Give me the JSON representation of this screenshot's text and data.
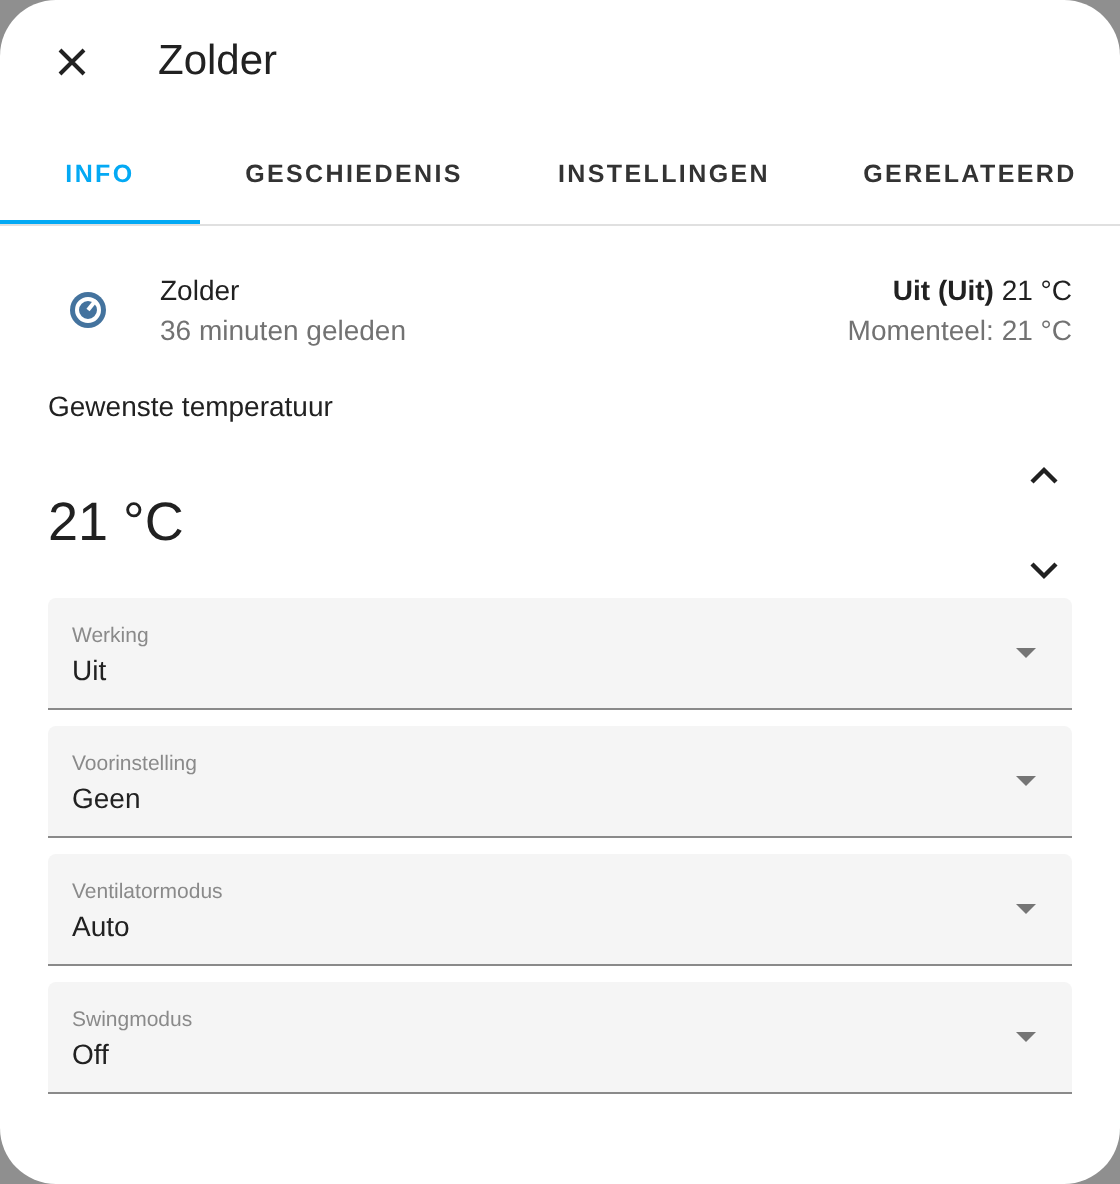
{
  "dialog": {
    "title": "Zolder"
  },
  "tabs": [
    {
      "label": "INFO",
      "selected": true
    },
    {
      "label": "GESCHIEDENIS",
      "selected": false
    },
    {
      "label": "INSTELLINGEN",
      "selected": false
    },
    {
      "label": "GERELATEERD",
      "selected": false
    }
  ],
  "entity": {
    "name": "Zolder",
    "last_changed": "36 minuten geleden",
    "state": "Uit (Uit)",
    "state_temp": "21 °C",
    "current": "Momenteel: 21 °C"
  },
  "target": {
    "label": "Gewenste temperatuur",
    "value": "21 °C"
  },
  "selects": [
    {
      "label": "Werking",
      "value": "Uit"
    },
    {
      "label": "Voorinstelling",
      "value": "Geen"
    },
    {
      "label": "Ventilatormodus",
      "value": "Auto"
    },
    {
      "label": "Swingmodus",
      "value": "Off"
    }
  ]
}
